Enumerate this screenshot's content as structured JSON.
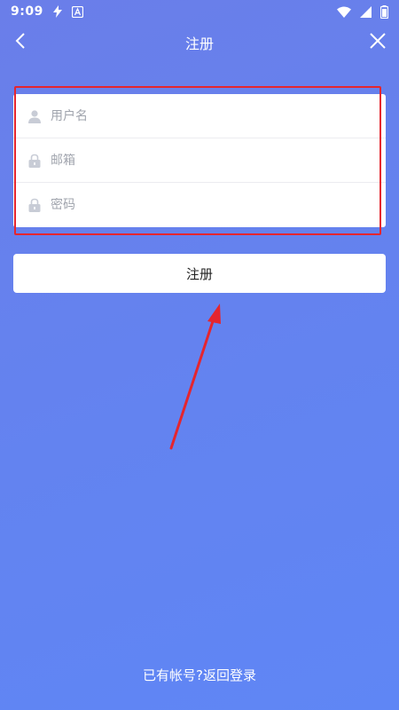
{
  "status_bar": {
    "time": "9:09",
    "icons": [
      "flash-icon",
      "app-notification-icon",
      "wifi-icon",
      "signal-icon",
      "battery-icon"
    ]
  },
  "nav": {
    "title": "注册",
    "back_icon": "chevron-left-icon",
    "close_icon": "close-icon"
  },
  "form": {
    "fields": [
      {
        "name": "username",
        "placeholder": "用户名",
        "value": "",
        "icon": "user-icon"
      },
      {
        "name": "email",
        "placeholder": "邮箱",
        "value": "",
        "icon": "lock-icon"
      },
      {
        "name": "password",
        "placeholder": "密码",
        "value": "",
        "icon": "lock-icon"
      }
    ],
    "submit_label": "注册"
  },
  "footer": {
    "login_link": "已有帐号?返回登录"
  },
  "colors": {
    "background": "#6383f0",
    "annotation": "#e5252e",
    "card": "#ffffff",
    "placeholder": "#a0a4ad",
    "icon": "#c8ccd6"
  }
}
